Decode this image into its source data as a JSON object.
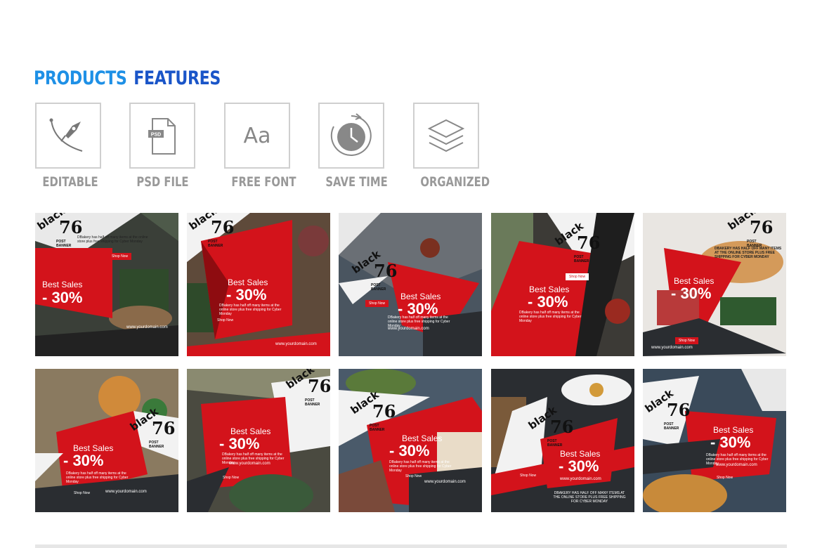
{
  "title": {
    "word1": "PRODUCTS",
    "word2": "FEATURES"
  },
  "features": [
    {
      "label": "EDITABLE",
      "icon": "pen-tool-icon"
    },
    {
      "label": "PSD FILE",
      "icon": "psd-file-icon",
      "badge": "PSD"
    },
    {
      "label": "FREE FONT",
      "icon": "font-icon",
      "glyph": "Aa"
    },
    {
      "label": "SAVE TIME",
      "icon": "clock-icon"
    },
    {
      "label": "ORGANIZED",
      "icon": "layers-icon"
    }
  ],
  "banner": {
    "logo_word": "black",
    "logo_number": "76",
    "logo_sub": "POST BANNER",
    "headline": "Best Sales",
    "discount": "- 30%",
    "desc": "DBakery has half off many items at the online store plus free shipping for Cyber Monday",
    "desc_caps": "DBAKERY HAS HALF OFF MANY ITEMS AT THE ONLINE STORE PLUS FREE SHIPPING FOR CYBER MONDAY",
    "shop": "Shop Now",
    "domain": "www.yourdomain.com"
  },
  "colors": {
    "accent_red": "#d3131b",
    "dark_red": "#8e0c10",
    "dark_gray": "#2a2d31",
    "title_blue": "#1e90e6",
    "title_blue_dark": "#1a55c8"
  }
}
